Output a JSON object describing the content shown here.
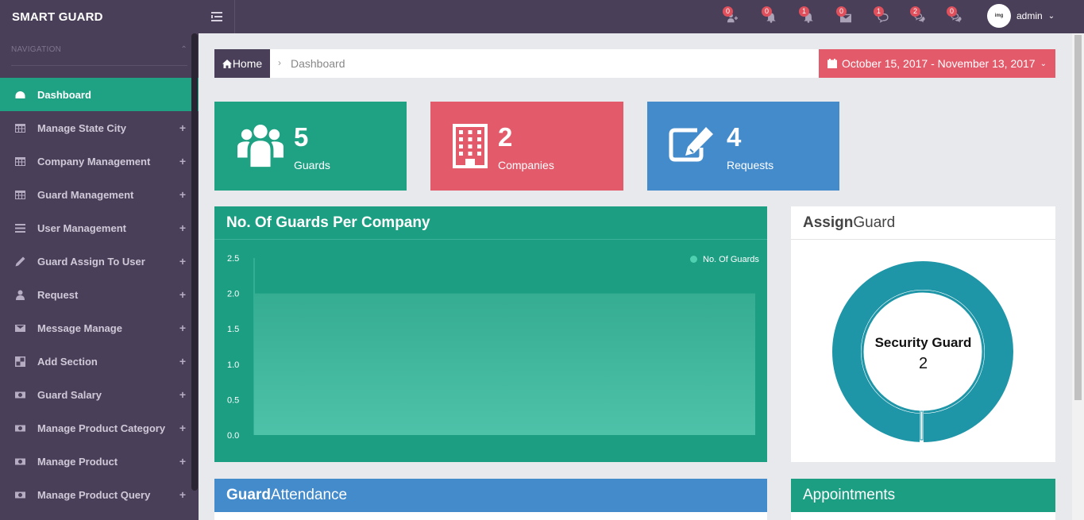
{
  "app": {
    "brand": "SMART GUARD"
  },
  "sidebar": {
    "section_label": "NAVIGATION",
    "items": [
      {
        "label": "Dashboard",
        "icon": "dashboard-icon",
        "active": true
      },
      {
        "label": "Manage State City",
        "icon": "table-icon"
      },
      {
        "label": "Company Management",
        "icon": "table-icon"
      },
      {
        "label": "Guard Management",
        "icon": "table-icon"
      },
      {
        "label": "User Management",
        "icon": "list-icon"
      },
      {
        "label": "Guard Assign To User",
        "icon": "pencil-icon"
      },
      {
        "label": "Request",
        "icon": "user-icon"
      },
      {
        "label": "Message Manage",
        "icon": "envelope-icon"
      },
      {
        "label": "Add Section",
        "icon": "section-icon"
      },
      {
        "label": "Guard Salary",
        "icon": "money-icon"
      },
      {
        "label": "Manage Product Category",
        "icon": "money-icon"
      },
      {
        "label": "Manage Product",
        "icon": "money-icon"
      },
      {
        "label": "Manage Product Query",
        "icon": "money-icon"
      }
    ]
  },
  "topbar": {
    "notifications": [
      {
        "count": "0",
        "icon": "user-add-icon"
      },
      {
        "count": "0",
        "icon": "bell-icon"
      },
      {
        "count": "1",
        "icon": "bell-icon"
      },
      {
        "count": "0",
        "icon": "envelope-icon"
      },
      {
        "count": "1",
        "icon": "comment-icon"
      },
      {
        "count": "2",
        "icon": "comments-icon"
      },
      {
        "count": "0",
        "icon": "comments-icon"
      }
    ],
    "user_name": "admin"
  },
  "breadcrumb": {
    "home": "Home",
    "current": "Dashboard",
    "date_range": "October 15, 2017 - November 13, 2017"
  },
  "stats": [
    {
      "value": "5",
      "label": "Guards",
      "color": "#1fa283",
      "icon": "users-icon"
    },
    {
      "value": "2",
      "label": "Companies",
      "color": "#e35b6b",
      "icon": "building-icon"
    },
    {
      "value": "4",
      "label": "Requests",
      "color": "#448bcc",
      "icon": "edit-icon"
    }
  ],
  "chart_panel": {
    "title": "No. Of Guards Per Company"
  },
  "chart_data": {
    "type": "area",
    "title": "No. Of Guards Per Company",
    "series": [
      {
        "name": "No. Of Guards",
        "values": [
          2,
          2
        ]
      }
    ],
    "y_ticks": [
      "2.5",
      "2.0",
      "1.5",
      "1.0",
      "0.5",
      "0.0"
    ],
    "ylim": [
      0,
      2.5
    ],
    "legend": "top-right",
    "grid": false
  },
  "assign_panel": {
    "title_bold": "Assign",
    "title_light": " Guard",
    "donut_label": "Security Guard",
    "donut_value": "2",
    "color": "#1e96a8"
  },
  "attendance_panel": {
    "title_bold": "Guard",
    "title_light": " Attendance"
  },
  "appointments_panel": {
    "title": "Appointments"
  }
}
